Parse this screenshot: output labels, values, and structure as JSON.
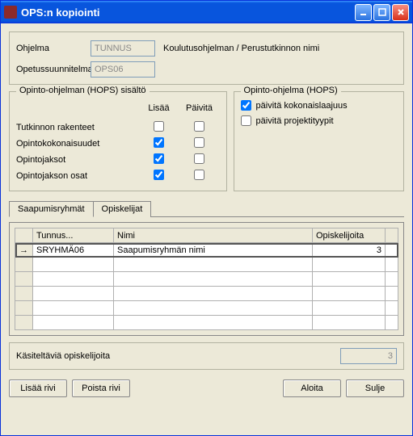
{
  "window": {
    "title": "OPS:n kopiointi"
  },
  "form": {
    "ohjelma_label": "Ohjelma",
    "ohjelma_value": "TUNNUS",
    "ohjelma_desc": "Koulutusohjelman / Perustutkinnon nimi",
    "ops_label": "Opetussuunnitelma",
    "ops_value": "OPS06"
  },
  "left_group": {
    "title": "Opinto-ohjelman (HOPS) sisältö",
    "col_add": "Lisää",
    "col_update": "Päivitä",
    "rows": [
      {
        "label": "Tutkinnon rakenteet",
        "add": false,
        "update": false
      },
      {
        "label": "Opintokokonaisuudet",
        "add": true,
        "update": false
      },
      {
        "label": "Opintojaksot",
        "add": true,
        "update": false
      },
      {
        "label": "Opintojakson osat",
        "add": true,
        "update": false
      }
    ]
  },
  "right_group": {
    "title": "Opinto-ohjelma (HOPS)",
    "opt1": {
      "label": "päivitä kokonaislaajuus",
      "checked": true
    },
    "opt2": {
      "label": "päivitä projektityypit",
      "checked": false
    }
  },
  "tabs": {
    "active": "Saapumisryhmät",
    "other": "Opiskelijat"
  },
  "grid": {
    "col_tunnus": "Tunnus...",
    "col_nimi": "Nimi",
    "col_opisk": "Opiskelijoita",
    "rows": [
      {
        "tunnus": "SRYHMÄ06",
        "nimi": "Saapumisryhmän nimi",
        "opisk": "3"
      }
    ],
    "empty_rows": 5
  },
  "summary": {
    "label": "Käsiteltäviä opiskelijoita",
    "value": "3"
  },
  "buttons": {
    "add_row": "Lisää rivi",
    "del_row": "Poista rivi",
    "start": "Aloita",
    "close": "Sulje"
  }
}
